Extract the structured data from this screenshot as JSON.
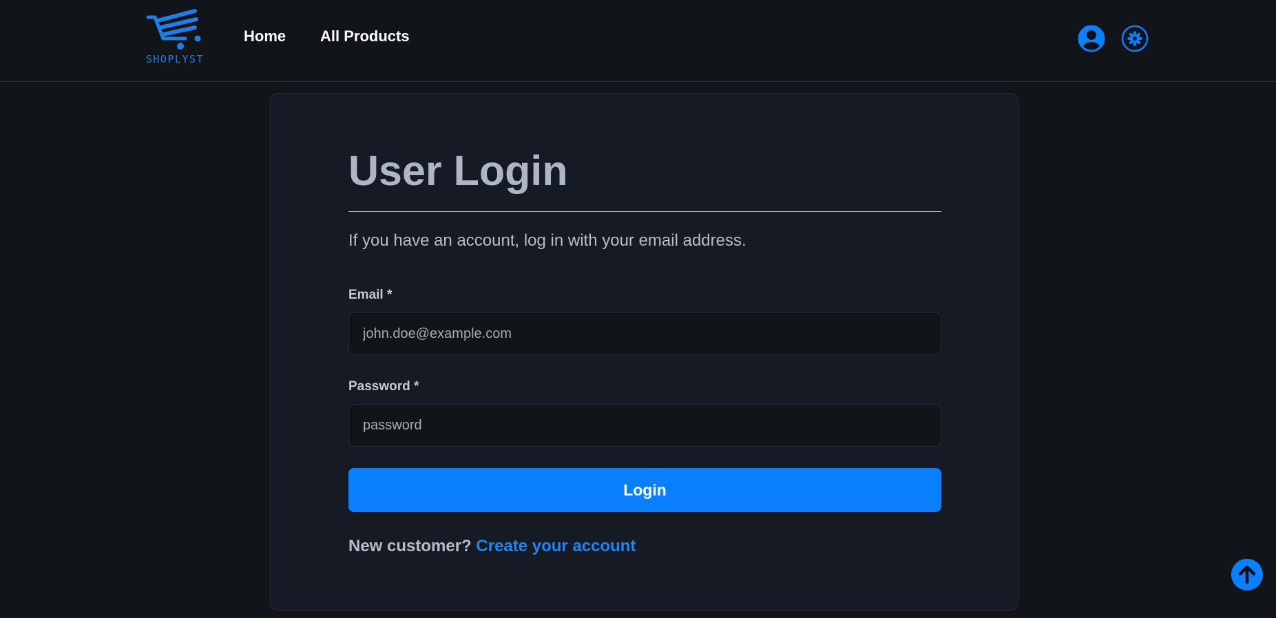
{
  "brand": {
    "name": "SHOPLYST",
    "accent": "#0a80ff"
  },
  "nav": {
    "links": [
      {
        "label": "Home"
      },
      {
        "label": "All Products"
      }
    ],
    "icons": [
      "user-circle-icon",
      "gear-icon"
    ]
  },
  "login": {
    "title": "User Login",
    "subtitle": "If you have an account, log in with your email address.",
    "email": {
      "label": "Email *",
      "placeholder": "john.doe@example.com",
      "value": ""
    },
    "password": {
      "label": "Password *",
      "placeholder": "password",
      "value": ""
    },
    "submit_label": "Login",
    "signup_prompt": "New customer?",
    "signup_link": "Create your account"
  },
  "scroll_top": {
    "icon": "arrow-up-icon"
  }
}
